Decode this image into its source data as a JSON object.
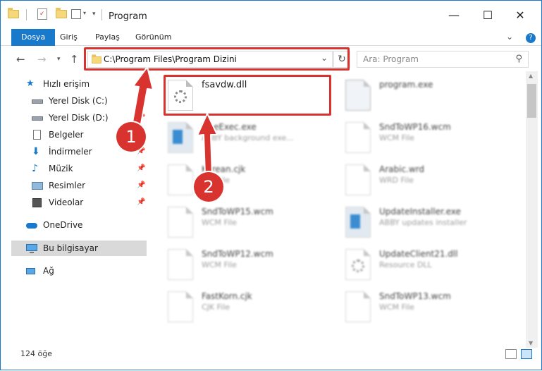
{
  "window": {
    "title": "Program",
    "controls": {
      "minimize": "—",
      "maximize": "☐",
      "close": "✕"
    }
  },
  "ribbon": {
    "tabs": [
      "Dosya",
      "Giriş",
      "Paylaş",
      "Görünüm"
    ],
    "expand_icon": "chevron-down-icon",
    "help_icon": "help-icon"
  },
  "nav": {
    "address_path": "C:\\Program Files\\Program Dizini",
    "search_placeholder": "Ara: Program"
  },
  "sidebar": {
    "items": [
      {
        "label": "Hızlı erişim",
        "icon": "star-icon"
      },
      {
        "label": "Yerel Disk (C:)",
        "icon": "drive-icon",
        "pinned": true
      },
      {
        "label": "Yerel Disk (D:)",
        "icon": "drive-icon",
        "pinned": true
      },
      {
        "label": "Belgeler",
        "icon": "documents-icon",
        "pinned": true
      },
      {
        "label": "İndirmeler",
        "icon": "download-icon",
        "pinned": true
      },
      {
        "label": "Müzik",
        "icon": "music-icon",
        "pinned": true
      },
      {
        "label": "Resimler",
        "icon": "pictures-icon",
        "pinned": true
      },
      {
        "label": "Videolar",
        "icon": "videos-icon",
        "pinned": true
      },
      {
        "label": "OneDrive",
        "icon": "cloud-icon"
      },
      {
        "label": "Bu bilgisayar",
        "icon": "computer-icon",
        "selected": true
      },
      {
        "label": "Ağ",
        "icon": "network-icon"
      }
    ]
  },
  "files": [
    {
      "name": "fsavdw.dll",
      "type": ""
    },
    {
      "name": "program.exe",
      "type": ""
    },
    {
      "name": "FineExec.exe",
      "type": "ABBY background exe..."
    },
    {
      "name": "SndToWP16.wcm",
      "type": "WCM File"
    },
    {
      "name": "Korean.cjk",
      "type": "CJK File"
    },
    {
      "name": "Arabic.wrd",
      "type": "WRD File"
    },
    {
      "name": "SndToWP15.wcm",
      "type": "WCM File"
    },
    {
      "name": "UpdateInstaller.exe",
      "type": "ABBY updates installer"
    },
    {
      "name": "SndToWP12.wcm",
      "type": "WCM File"
    },
    {
      "name": "UpdateClient21.dll",
      "type": "Resource DLL"
    },
    {
      "name": "FastKorn.cjk",
      "type": "CJK File"
    },
    {
      "name": "SndToWP13.wcm",
      "type": "WCM File"
    }
  ],
  "status": {
    "count": "124 öğe"
  },
  "annotations": {
    "badge1": "1",
    "badge2": "2",
    "color": "#d9332f"
  },
  "colors": {
    "accent": "#1979ca",
    "highlight": "#d9332f"
  }
}
